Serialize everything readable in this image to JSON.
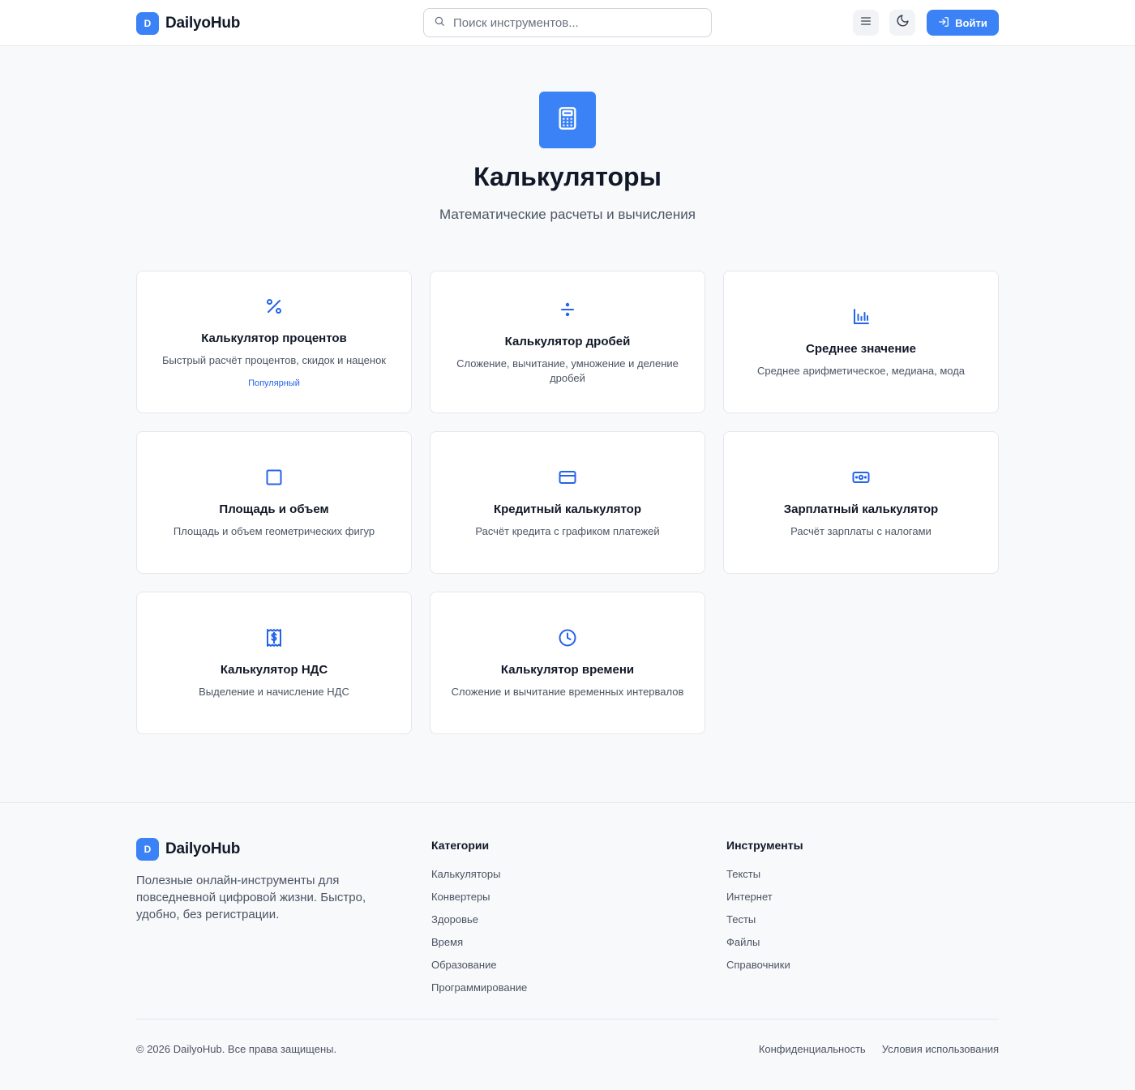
{
  "brand": {
    "initial": "D",
    "name": "DailyoHub",
    "accent": "#3b82f6"
  },
  "header": {
    "search_placeholder": "Поиск инструментов...",
    "login_label": "Войти"
  },
  "hero": {
    "icon": "calculator-icon",
    "title": "Калькуляторы",
    "subtitle": "Математические расчеты и вычисления"
  },
  "tools": [
    {
      "icon": "percent-icon",
      "title": "Калькулятор процентов",
      "desc": "Быстрый расчёт процентов, скидок и наценок",
      "badge": "Популярный"
    },
    {
      "icon": "divide-icon",
      "title": "Калькулятор дробей",
      "desc": "Сложение, вычитание, умножение и деление дробей",
      "badge": ""
    },
    {
      "icon": "bar-chart-icon",
      "title": "Среднее значение",
      "desc": "Среднее арифметическое, медиана, мода",
      "badge": ""
    },
    {
      "icon": "square-icon",
      "title": "Площадь и объем",
      "desc": "Площадь и объем геометрических фигур",
      "badge": ""
    },
    {
      "icon": "credit-card-icon",
      "title": "Кредитный калькулятор",
      "desc": "Расчёт кредита с графиком платежей",
      "badge": ""
    },
    {
      "icon": "banknote-icon",
      "title": "Зарплатный калькулятор",
      "desc": "Расчёт зарплаты с налогами",
      "badge": ""
    },
    {
      "icon": "receipt-icon",
      "title": "Калькулятор НДС",
      "desc": "Выделение и начисление НДС",
      "badge": ""
    },
    {
      "icon": "clock-icon",
      "title": "Калькулятор времени",
      "desc": "Сложение и вычитание временных интервалов",
      "badge": ""
    }
  ],
  "footer": {
    "about": "Полезные онлайн-инструменты для повседневной цифровой жизни. Быстро, удобно, без регистрации.",
    "categories_title": "Категории",
    "categories": [
      "Калькуляторы",
      "Конвертеры",
      "Здоровье",
      "Время",
      "Образование",
      "Программирование"
    ],
    "tools_title": "Инструменты",
    "tools": [
      "Тексты",
      "Интернет",
      "Тесты",
      "Файлы",
      "Справочники"
    ],
    "copyright": "© 2026 DailyoHub. Все права защищены.",
    "privacy": "Конфиденциальность",
    "terms": "Условия использования"
  }
}
